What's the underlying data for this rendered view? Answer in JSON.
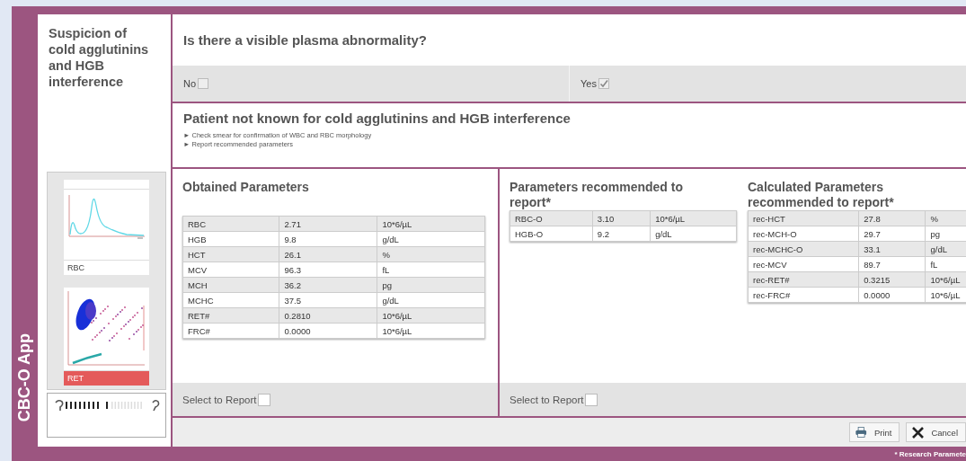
{
  "app_title": "CBC-O App",
  "sidebar": {
    "title": "Suspicion of cold agglutinins and HGB interference",
    "thumbnails": [
      {
        "label": "RBC",
        "kind": "histogram",
        "selected": false
      },
      {
        "label": "RET",
        "kind": "scatter",
        "selected": true
      }
    ]
  },
  "question": {
    "text": "Is there a visible plasma abnormality?",
    "options": [
      {
        "label": "No",
        "checked": false
      },
      {
        "label": "Yes",
        "checked": true
      }
    ]
  },
  "result": {
    "title": "Patient not known for cold agglutinins and HGB interference",
    "bullets": [
      "► Check smear for confirmation of WBC and RBC morphology",
      "► Report recommended parameters"
    ]
  },
  "report_groups": [
    {
      "sections": [
        {
          "title": "Obtained Parameters",
          "rows": [
            {
              "name": "RBC",
              "value": "2.71",
              "unit": "10*6/µL"
            },
            {
              "name": "HGB",
              "value": "9.8",
              "unit": "g/dL"
            },
            {
              "name": "HCT",
              "value": "26.1",
              "unit": "%"
            },
            {
              "name": "MCV",
              "value": "96.3",
              "unit": "fL"
            },
            {
              "name": "MCH",
              "value": "36.2",
              "unit": "pg"
            },
            {
              "name": "MCHC",
              "value": "37.5",
              "unit": "g/dL"
            },
            {
              "name": "RET#",
              "value": "0.2810",
              "unit": "10*6/µL"
            },
            {
              "name": "FRC#",
              "value": "0.0000",
              "unit": "10*6/µL"
            }
          ]
        }
      ],
      "select_label": "Select to Report",
      "checked": false
    },
    {
      "sections": [
        {
          "title": "Parameters recommended to report*",
          "rows": [
            {
              "name": "RBC-O",
              "value": "3.10",
              "unit": "10*6/µL"
            },
            {
              "name": "HGB-O",
              "value": "9.2",
              "unit": "g/dL"
            }
          ]
        },
        {
          "title": "Calculated Parameters recommended to report*",
          "rows": [
            {
              "name": "rec-HCT",
              "value": "27.8",
              "unit": "%"
            },
            {
              "name": "rec-MCH-O",
              "value": "29.7",
              "unit": "pg"
            },
            {
              "name": "rec-MCHC-O",
              "value": "33.1",
              "unit": "g/dL"
            },
            {
              "name": "rec-MCV",
              "value": "89.7",
              "unit": "fL"
            },
            {
              "name": "rec-RET#",
              "value": "0.3215",
              "unit": "10*6/µL"
            },
            {
              "name": "rec-FRC#",
              "value": "0.0000",
              "unit": "10*6/µL"
            }
          ]
        }
      ],
      "select_label": "Select to Report",
      "checked": false
    }
  ],
  "buttons": [
    {
      "kind": "print",
      "label": "Print"
    },
    {
      "kind": "cancel",
      "label": "Cancel"
    }
  ],
  "footnote": "* Research Paramete"
}
